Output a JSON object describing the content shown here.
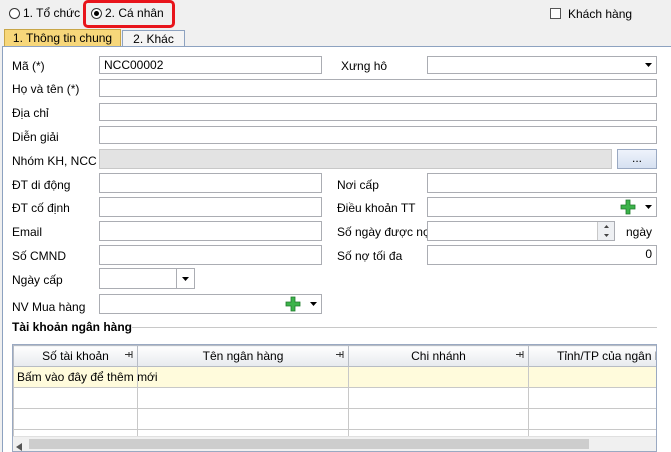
{
  "header": {
    "radio_org": "1. Tổ chức",
    "radio_personal": "2. Cá nhân",
    "customer_checkbox": "Khách hàng"
  },
  "tabs": [
    {
      "label": "1. Thông tin chung",
      "active": true
    },
    {
      "label": "2. Khác",
      "active": false
    }
  ],
  "form": {
    "code_label": "Mã (*)",
    "code_value": "NCC00002",
    "salutation_label": "Xưng hô",
    "fullname_label": "Họ và tên (*)",
    "address_label": "Địa chỉ",
    "description_label": "Diễn giải",
    "group_label": "Nhóm KH, NCC",
    "group_button": "...",
    "mobile_label": "ĐT di động",
    "issue_place_label": "Nơi cấp",
    "landline_label": "ĐT cố định",
    "payment_terms_label": "Điều khoản TT",
    "email_label": "Email",
    "credit_days_label": "Số ngày được nợ",
    "credit_days_unit": "ngày",
    "id_number_label": "Số CMND",
    "max_debt_label": "Số nợ tối đa",
    "max_debt_value": "0",
    "issue_date_label": "Ngày cấp",
    "buyer_label": "NV Mua hàng"
  },
  "bank_section": {
    "title": "Tài khoản ngân hàng",
    "columns": [
      "Số tài khoản",
      "Tên ngân hàng",
      "Chi nhánh",
      "Tỉnh/TP của ngân hà"
    ],
    "new_row_hint": "Bấm vào đây để thêm mới"
  },
  "colors": {
    "active_tab": "#f7d77a",
    "highlight_box": "#e8141b",
    "new_row_bg": "#fffbdc",
    "plus_icon": "#3cb34a"
  },
  "icons": [
    "chevron-down-icon",
    "plus-icon",
    "spin-up-icon",
    "spin-down-icon",
    "pin-icon",
    "scroll-left-icon"
  ]
}
